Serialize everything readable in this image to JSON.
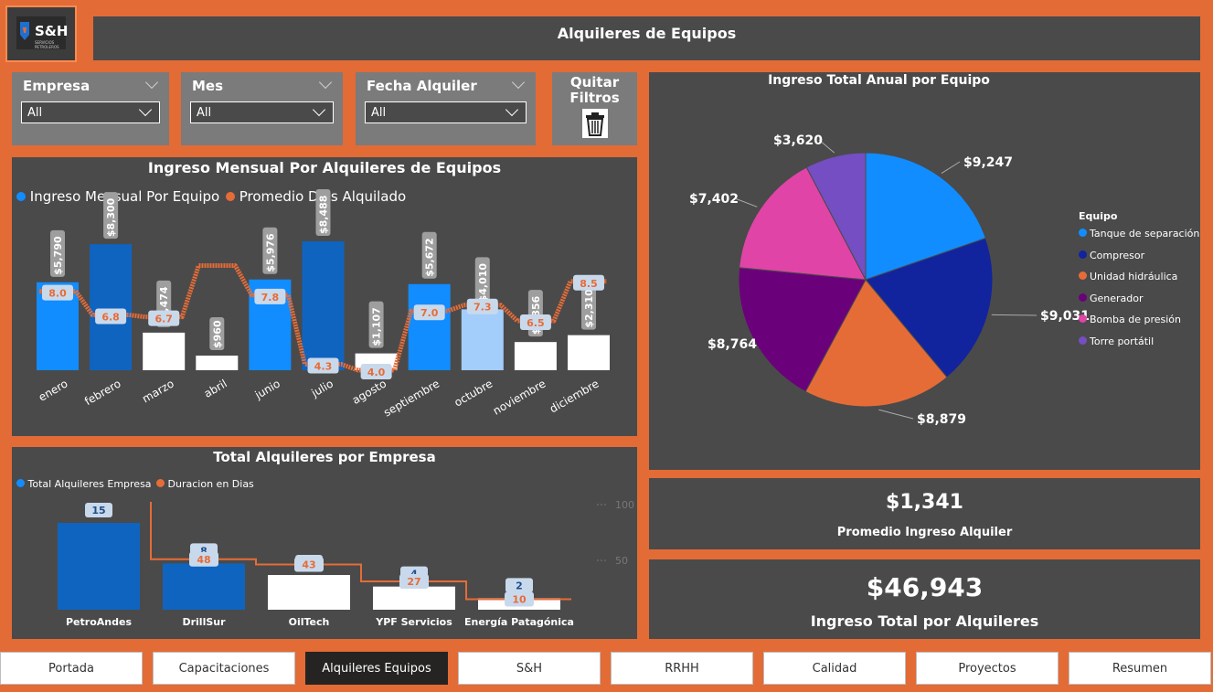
{
  "header": {
    "logo_text": "S&H",
    "logo_sub": "SERVICIOS PETROLEROS",
    "title": "Alquileres de Equipos"
  },
  "filters": [
    {
      "label": "Empresa",
      "value": "All"
    },
    {
      "label": "Mes",
      "value": "All"
    },
    {
      "label": "Fecha Alquiler",
      "value": "All"
    }
  ],
  "clear_button": {
    "line1": "Quitar",
    "line2": "Filtros"
  },
  "monthly_chart": {
    "title": "Ingreso Mensual Por Alquileres de Equipos",
    "legend": [
      "Ingreso Mensual Por Equipo",
      "Promedio Dias Alquilado"
    ]
  },
  "company_chart": {
    "title": "Total Alquileres por Empresa",
    "legend": [
      "Total Alquileres Empresa",
      "Duracion en Dias"
    ],
    "axis_ticks": [
      "100",
      "50"
    ]
  },
  "pie_chart": {
    "title": "Ingreso Total Anual por Equipo",
    "legend_title": "Equipo"
  },
  "kpi_avg": {
    "value": "$1,341",
    "label": "Promedio Ingreso Alquiler"
  },
  "kpi_total": {
    "value": "$46,943",
    "label": "Ingreso Total por Alquileres"
  },
  "tabs": [
    "Portada",
    "Capacitaciones",
    "Alquileres Equipos",
    "S&H",
    "RRHH",
    "Calidad",
    "Proyectos",
    "Resumen"
  ],
  "active_tab": "Alquileres Equipos",
  "colors": {
    "accent": "#e36b36",
    "panel": "#4a4a4a",
    "blue": "#118dff",
    "dark_blue": "#0f64c0",
    "orange": "#e66c37"
  },
  "chart_data": [
    {
      "type": "bar",
      "title": "Ingreso Mensual Por Alquileres de Equipos",
      "categories": [
        "enero",
        "febrero",
        "marzo",
        "abril",
        "junio",
        "julio",
        "agosto",
        "septiembre",
        "octubre",
        "noviembre",
        "diciembre"
      ],
      "series": [
        {
          "name": "Ingreso Mensual Por Equipo",
          "values": [
            5790,
            8300,
            2474,
            960,
            5976,
            8488,
            1107,
            5672,
            4010,
            1856,
            2310
          ],
          "labels": [
            "$5,790",
            "$8,300",
            "$2,474",
            "$960",
            "$5,976",
            "$8,488",
            "$1,107",
            "$5,672",
            "$4,010",
            "$1,856",
            "$2,310"
          ]
        },
        {
          "name": "Promedio Dias Alquilado",
          "values": [
            8.0,
            6.8,
            6.7,
            9.3,
            7.8,
            4.3,
            4.0,
            7.0,
            7.3,
            6.5,
            8.5
          ],
          "labels": [
            "8.0",
            "6.8",
            "6.7",
            "",
            "7.8",
            "4.3",
            "4.0",
            "7.0",
            "7.3",
            "6.5",
            "8.5"
          ]
        }
      ]
    },
    {
      "type": "bar",
      "title": "Total Alquileres por Empresa",
      "categories": [
        "PetroAndes",
        "DrillSur",
        "OilTech",
        "YPF Servicios",
        "Energía Patagónica"
      ],
      "series": [
        {
          "name": "Total Alquileres Empresa",
          "values": [
            15,
            8,
            6,
            4,
            2
          ]
        },
        {
          "name": "Duracion en Dias",
          "values": [
            108,
            48,
            43,
            27,
            10
          ],
          "labels": [
            "",
            "48",
            "43",
            "27",
            "10"
          ]
        }
      ],
      "y2_ticks": [
        100,
        50
      ]
    },
    {
      "type": "pie",
      "title": "Ingreso Total Anual por Equipo",
      "legend_title": "Equipo",
      "categories": [
        "Tanque de separación",
        "Compresor",
        "Unidad hidráulica",
        "Generador",
        "Bomba de presión",
        "Torre portátil"
      ],
      "values": [
        9247,
        9031,
        8879,
        8764,
        7402,
        3620
      ],
      "labels": [
        "$9,247",
        "$9,031",
        "$8,879",
        "$8,764",
        "$7,402",
        "$3,620"
      ],
      "colors": [
        "#118dff",
        "#12239e",
        "#e66c37",
        "#6b007b",
        "#e044a7",
        "#744ec2"
      ],
      "legend_position": "right"
    }
  ]
}
